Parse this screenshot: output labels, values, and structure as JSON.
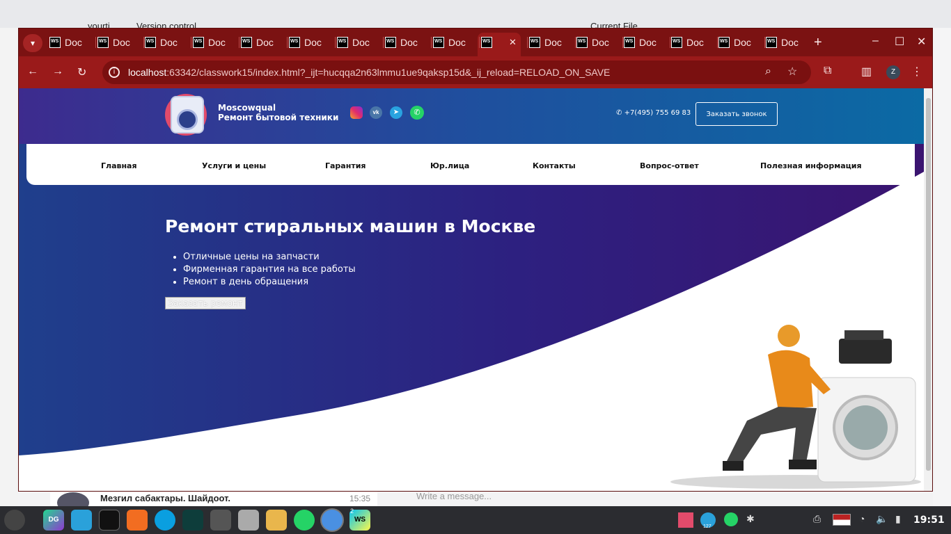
{
  "background_app": {
    "project": "yourti",
    "vcs": "Version control",
    "current_file": "Current File",
    "chat_preview_text": "Мезгил сабактары. Шайдоот.",
    "chat_preview_time": "15:35",
    "message_placeholder": "Write a message..."
  },
  "browser": {
    "tabs": [
      {
        "label": "Doc"
      },
      {
        "label": "Doc"
      },
      {
        "label": "Doc"
      },
      {
        "label": "Doc"
      },
      {
        "label": "Doc"
      },
      {
        "label": "Doc"
      },
      {
        "label": "Doc"
      },
      {
        "label": "Doc"
      },
      {
        "label": "Doc"
      },
      {
        "label": ""
      },
      {
        "label": "Doc"
      },
      {
        "label": "Doc"
      },
      {
        "label": "Doc"
      },
      {
        "label": "Doc"
      },
      {
        "label": "Doc"
      },
      {
        "label": "Doc"
      }
    ],
    "tab_icon_text": "WS",
    "url_host": "localhost",
    "url_rest": ":63342/classwork15/index.html?_ijt=hucqqa2n63lmmu1ue9qaksp15d&_ij_reload=RELOAD_ON_SAVE",
    "profile_initial": "Z"
  },
  "site": {
    "brand_name": "Moscowqual",
    "brand_sub": "Ремонт бытовой техники",
    "phone": "+7(495) 755 69 83",
    "call_button": "Заказать звонок",
    "nav": [
      "Главная",
      "Услуги и цены",
      "Гарантия",
      "Юр.лица",
      "Контакты",
      "Вопрос-ответ",
      "Полезная информация"
    ],
    "hero_title": "Ремонт стиральных машин в Москве",
    "hero_points": [
      "Отличные цены на запчасти",
      "Фирменная гарантия на все работы",
      "Ремонт в день обращения"
    ],
    "order_button": "Заказать ремонт",
    "social": [
      "instagram-icon",
      "vk-icon",
      "telegram-icon",
      "whatsapp-icon"
    ]
  },
  "taskbar": {
    "clock": "19:51",
    "datagrip_label": "DG",
    "webstorm_label": "WS",
    "webstorm_count": "2",
    "telegram_badge": "127"
  },
  "colors": {
    "tabstrip": "#7b1212",
    "addressbar": "#9a1a1a",
    "hero_start": "#1f3f8c",
    "hero_end": "#3a1470"
  }
}
